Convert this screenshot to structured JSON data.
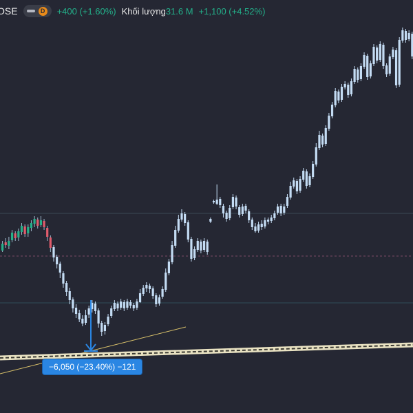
{
  "header": {
    "symbol": "OSE",
    "interval_badge": "D",
    "change": "+400 (+1.60%)",
    "volume_label": "Khối lượng",
    "volume_value": "31.6 M",
    "volume_change": "+1,100 (+4.52%)"
  },
  "measurement": {
    "label": "−6,050 (−23.40%) −121"
  },
  "colors": {
    "background": "#252733",
    "candle": "#c4dcf4",
    "candle_down_small": "#e05c6c",
    "candle_up_small": "#27b08a",
    "accent_green": "#23b08a",
    "measure_blue": "#2a86e3",
    "trendline": "#d8c06a"
  },
  "chart_data": {
    "type": "ohlc",
    "title": "",
    "series": [
      {
        "values": [
          [
            364,
            354,
            366,
            350
          ],
          [
            352,
            356,
            360,
            346
          ],
          [
            357,
            350,
            362,
            344
          ],
          [
            349,
            338,
            352,
            334
          ],
          [
            339,
            346,
            350,
            336
          ],
          [
            345,
            336,
            350,
            332
          ],
          [
            337,
            328,
            341,
            324
          ],
          [
            329,
            340,
            344,
            326
          ],
          [
            339,
            330,
            344,
            326
          ],
          [
            331,
            324,
            336,
            320
          ],
          [
            325,
            318,
            330,
            314
          ],
          [
            319,
            328,
            332,
            316
          ],
          [
            327,
            320,
            330,
            314
          ],
          [
            321,
            330,
            334,
            318
          ],
          [
            331,
            344,
            350,
            328
          ],
          [
            345,
            360,
            366,
            342
          ],
          [
            359,
            374,
            380,
            356
          ],
          [
            373,
            384,
            390,
            370
          ],
          [
            383,
            396,
            404,
            380
          ],
          [
            397,
            412,
            418,
            394
          ],
          [
            411,
            424,
            430,
            408
          ],
          [
            423,
            436,
            442,
            418
          ],
          [
            435,
            448,
            454,
            432
          ],
          [
            447,
            456,
            462,
            442
          ],
          [
            455,
            464,
            468,
            450
          ],
          [
            463,
            470,
            474,
            458
          ],
          [
            469,
            458,
            472,
            450
          ],
          [
            457,
            448,
            462,
            444
          ],
          [
            449,
            440,
            454,
            436
          ],
          [
            441,
            452,
            456,
            438
          ],
          [
            451,
            470,
            476,
            448
          ],
          [
            469,
            482,
            488,
            466
          ],
          [
            481,
            472,
            486,
            468
          ],
          [
            471,
            460,
            474,
            456
          ],
          [
            459,
            448,
            462,
            444
          ],
          [
            449,
            440,
            452,
            436
          ],
          [
            441,
            448,
            452,
            438
          ],
          [
            447,
            438,
            450,
            434
          ],
          [
            439,
            448,
            452,
            436
          ],
          [
            447,
            438,
            450,
            434
          ],
          [
            439,
            444,
            448,
            436
          ],
          [
            443,
            448,
            452,
            440
          ],
          [
            447,
            438,
            450,
            434
          ],
          [
            439,
            426,
            440,
            420
          ],
          [
            427,
            418,
            430,
            414
          ],
          [
            419,
            414,
            424,
            410
          ],
          [
            415,
            420,
            426,
            412
          ],
          [
            419,
            430,
            434,
            416
          ],
          [
            429,
            442,
            446,
            426
          ],
          [
            441,
            432,
            444,
            428
          ],
          [
            431,
            420,
            434,
            416
          ],
          [
            421,
            396,
            424,
            390
          ],
          [
            397,
            380,
            400,
            376
          ],
          [
            381,
            356,
            384,
            350
          ],
          [
            357,
            334,
            360,
            328
          ],
          [
            335,
            318,
            338,
            312
          ],
          [
            319,
            310,
            322,
            304
          ],
          [
            311,
            324,
            328,
            308
          ],
          [
            323,
            348,
            352,
            320
          ],
          [
            347,
            376,
            380,
            344
          ],
          [
            375,
            362,
            378,
            358
          ],
          [
            363,
            350,
            366,
            346
          ],
          [
            351,
            364,
            368,
            348
          ],
          [
            363,
            350,
            366,
            346
          ],
          [
            351,
            366,
            370,
            348
          ],
          [
            322,
            318,
            324,
            316
          ],
          [
            294,
            292,
            296,
            290
          ],
          [
            296,
            290,
            298,
            268
          ],
          [
            289,
            298,
            302,
            286
          ],
          [
            299,
            310,
            316,
            296
          ],
          [
            309,
            318,
            322,
            306
          ],
          [
            317,
            302,
            320,
            298
          ],
          [
            301,
            286,
            304,
            282
          ],
          [
            287,
            300,
            304,
            284
          ],
          [
            301,
            312,
            316,
            298
          ],
          [
            311,
            300,
            314,
            296
          ],
          [
            299,
            306,
            310,
            296
          ],
          [
            307,
            320,
            324,
            304
          ],
          [
            319,
            330,
            334,
            316
          ],
          [
            329,
            336,
            338,
            324
          ],
          [
            335,
            326,
            338,
            322
          ],
          [
            325,
            330,
            334,
            320
          ],
          [
            329,
            320,
            332,
            316
          ],
          [
            319,
            322,
            326,
            316
          ],
          [
            321,
            316,
            324,
            312
          ],
          [
            317,
            310,
            320,
            306
          ],
          [
            309,
            300,
            312,
            296
          ],
          [
            299,
            310,
            314,
            296
          ],
          [
            309,
            300,
            312,
            296
          ],
          [
            299,
            286,
            302,
            282
          ],
          [
            287,
            270,
            290,
            264
          ],
          [
            271,
            262,
            274,
            258
          ],
          [
            263,
            278,
            282,
            260
          ],
          [
            277,
            260,
            280,
            256
          ],
          [
            261,
            248,
            264,
            244
          ],
          [
            249,
            270,
            274,
            246
          ],
          [
            269,
            256,
            272,
            252
          ],
          [
            257,
            238,
            260,
            234
          ],
          [
            239,
            214,
            242,
            208
          ],
          [
            215,
            196,
            218,
            190
          ],
          [
            197,
            210,
            214,
            194
          ],
          [
            209,
            186,
            212,
            182
          ],
          [
            187,
            168,
            190,
            164
          ],
          [
            169,
            152,
            172,
            148
          ],
          [
            153,
            132,
            156,
            128
          ],
          [
            133,
            146,
            150,
            130
          ],
          [
            145,
            126,
            148,
            122
          ],
          [
            127,
            122,
            130,
            118
          ],
          [
            123,
            138,
            142,
            120
          ],
          [
            137,
            118,
            140,
            114
          ],
          [
            119,
            100,
            122,
            96
          ],
          [
            101,
            116,
            120,
            98
          ],
          [
            115,
            96,
            118,
            92
          ],
          [
            97,
            80,
            100,
            76
          ],
          [
            81,
            112,
            116,
            78
          ],
          [
            111,
            92,
            114,
            88
          ],
          [
            93,
            68,
            96,
            64
          ],
          [
            69,
            88,
            92,
            66
          ],
          [
            87,
            64,
            90,
            60
          ],
          [
            65,
            96,
            100,
            62
          ],
          [
            95,
            108,
            112,
            92
          ],
          [
            107,
            82,
            110,
            78
          ],
          [
            83,
            72,
            86,
            68
          ],
          [
            73,
            124,
            128,
            70
          ],
          [
            123,
            58,
            126,
            54
          ],
          [
            59,
            44,
            62,
            40
          ],
          [
            45,
            58,
            62,
            42
          ],
          [
            57,
            48,
            60,
            44
          ],
          [
            49,
            82,
            86,
            46
          ],
          [
            81,
            100,
            104,
            78
          ],
          [
            99,
            130,
            134,
            96
          ]
        ]
      }
    ]
  }
}
